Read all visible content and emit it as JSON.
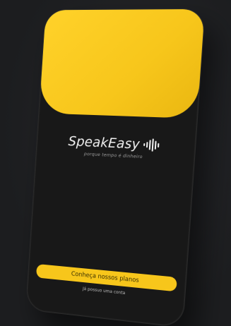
{
  "app": {
    "brand_name": "SpeakEasy",
    "tagline": "porque tempo é dinheiro",
    "logo_icon": "sound-wave-icon"
  },
  "actions": {
    "primary_label": "Conheça nossos planos",
    "secondary_label": "Já possuo uma conta"
  },
  "colors": {
    "background": "#1d1e20",
    "phone_body": "#181818",
    "accent_yellow": "#f7c61b",
    "text_light": "#f2f2f2",
    "text_muted": "#9a9a9a"
  }
}
